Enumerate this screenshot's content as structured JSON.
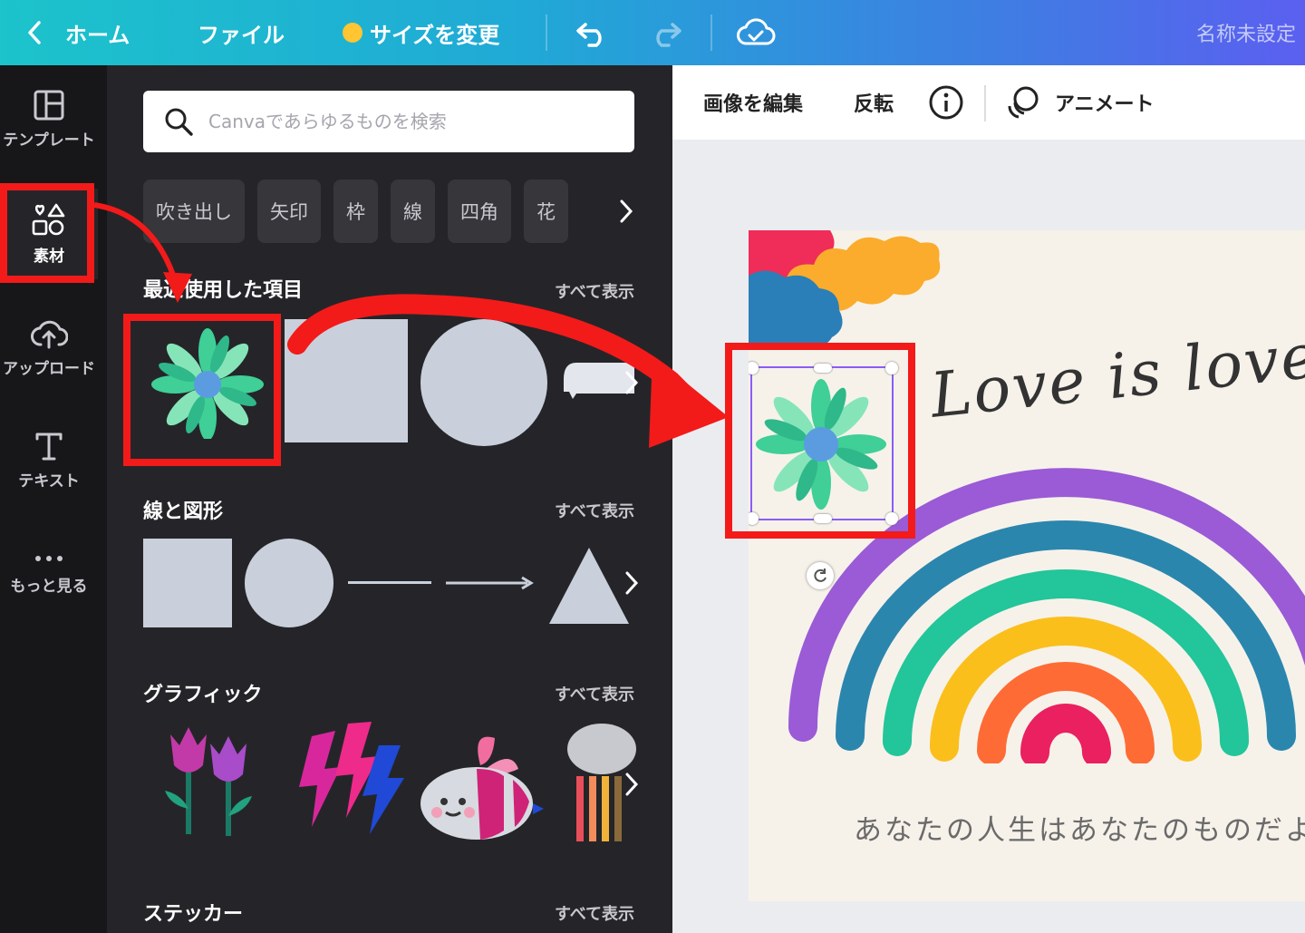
{
  "topbar": {
    "home": "ホーム",
    "file": "ファイル",
    "resize": "サイズを変更",
    "doc_title": "名称未設定"
  },
  "leftnav": [
    {
      "label": "テンプレート",
      "icon": "template-icon"
    },
    {
      "label": "素材",
      "icon": "elements-icon"
    },
    {
      "label": "アップロード",
      "icon": "upload-icon"
    },
    {
      "label": "テキスト",
      "icon": "text-icon"
    },
    {
      "label": "もっと見る",
      "icon": "more-icon"
    }
  ],
  "panel": {
    "search_placeholder": "Canvaであらゆるものを検索",
    "chips": [
      "吹き出し",
      "矢印",
      "枠",
      "線",
      "四角",
      "花"
    ],
    "recent_title": "最近使用した項目",
    "shapes_title": "線と図形",
    "graphics_title": "グラフィック",
    "stickers_title": "ステッカー",
    "see_all": "すべて表示"
  },
  "context_toolbar": {
    "edit_image": "画像を編集",
    "flip": "反転",
    "animate": "アニメート"
  },
  "design": {
    "headline": "Love is love!",
    "tagline": "あなたの人生はあなたのものだよ"
  },
  "colors": {
    "accent_red": "#f31a1a",
    "selection": "#8b5cf6"
  }
}
